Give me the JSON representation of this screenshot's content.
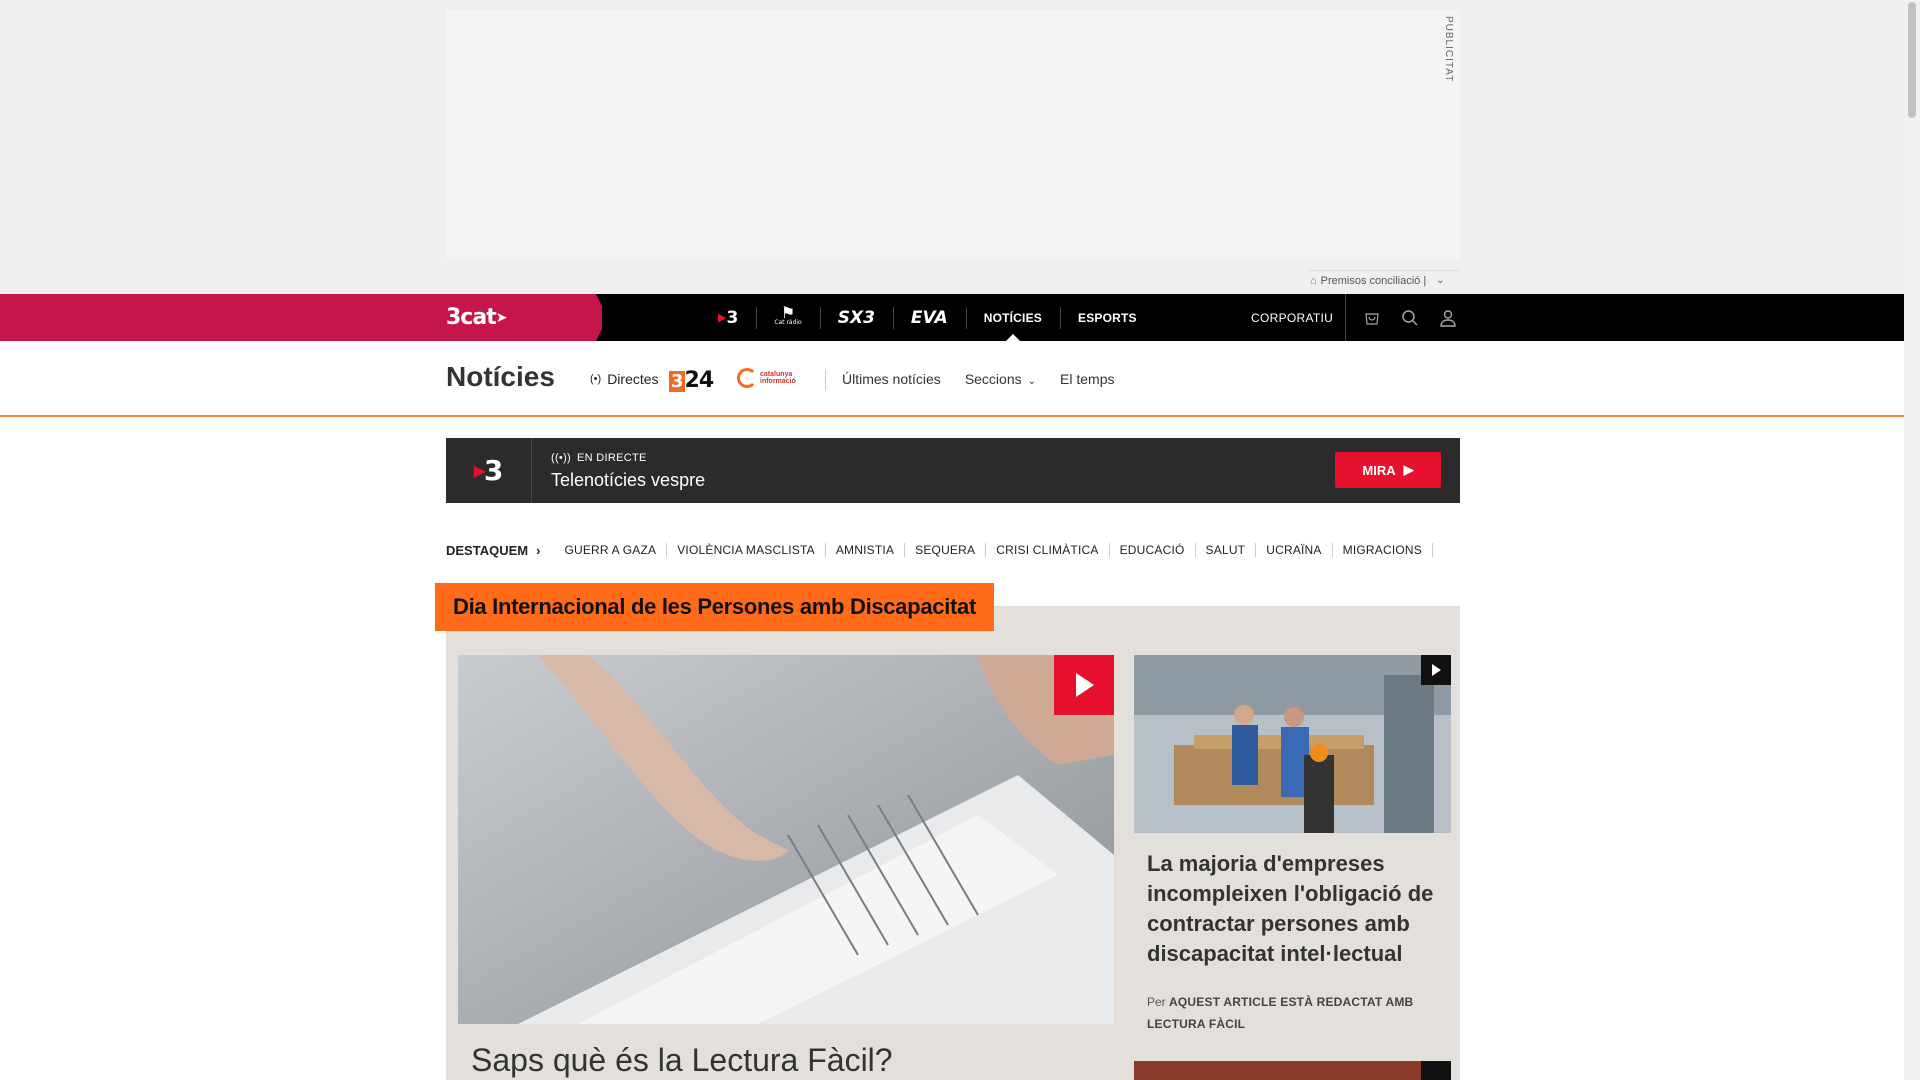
{
  "ad": {
    "label": "PUBLICITAT",
    "preferences": "Premisos conciliació |"
  },
  "topnav": {
    "brand": "3cat",
    "channels": [
      {
        "label": "3",
        "name": "tv3"
      },
      {
        "label": "Cat ràdio",
        "name": "catradio"
      },
      {
        "label": "SX3",
        "name": "sx3"
      },
      {
        "label": "EVA",
        "name": "eva"
      },
      {
        "label": "NOTÍCIES",
        "name": "noticies"
      },
      {
        "label": "ESPORTS",
        "name": "esports"
      }
    ],
    "corporate": "CORPORATIU",
    "icons": [
      "shop-icon",
      "search-icon",
      "user-icon"
    ]
  },
  "section": {
    "title": "Notícies",
    "directes": "Directes",
    "logo_324": "24",
    "logo_324_three": "3",
    "logo_ci": "catalunya informació",
    "links": {
      "ultimes": "Últimes notícies",
      "seccions": "Seccions",
      "temps": "El temps"
    }
  },
  "live": {
    "channel": "3",
    "label": "EN DIRECTE",
    "title": "Telenotícies vespre",
    "button": "MIRA"
  },
  "destaquem": {
    "lead": "DESTAQUEM",
    "tags": [
      "GUERR A GAZA",
      "VIOLÈNCIA MASCLISTA",
      "AMNISTIA",
      "SEQUERA",
      "CRISI CLIMÀTICA",
      "EDUCACIÓ",
      "SALUT",
      "UCRAÏNA",
      "MIGRACIONS"
    ]
  },
  "feature": {
    "title": "Dia Internacional de les Persones amb Discapacitat",
    "main_headline": "Saps què és la Lectura Fàcil?",
    "side_headline": "La majoria d'empreses incompleixen l'obligació de contractar persones amb discapacitat intel·lectual",
    "side_byline_prefix": "Per",
    "side_byline_author": "AQUEST ARTICLE ESTÀ REDACTAT AMB LECTURA FÀCIL"
  },
  "colors": {
    "brand_red": "#c5154a",
    "accent_orange": "#ff6b18",
    "live_red": "#e8112d"
  }
}
